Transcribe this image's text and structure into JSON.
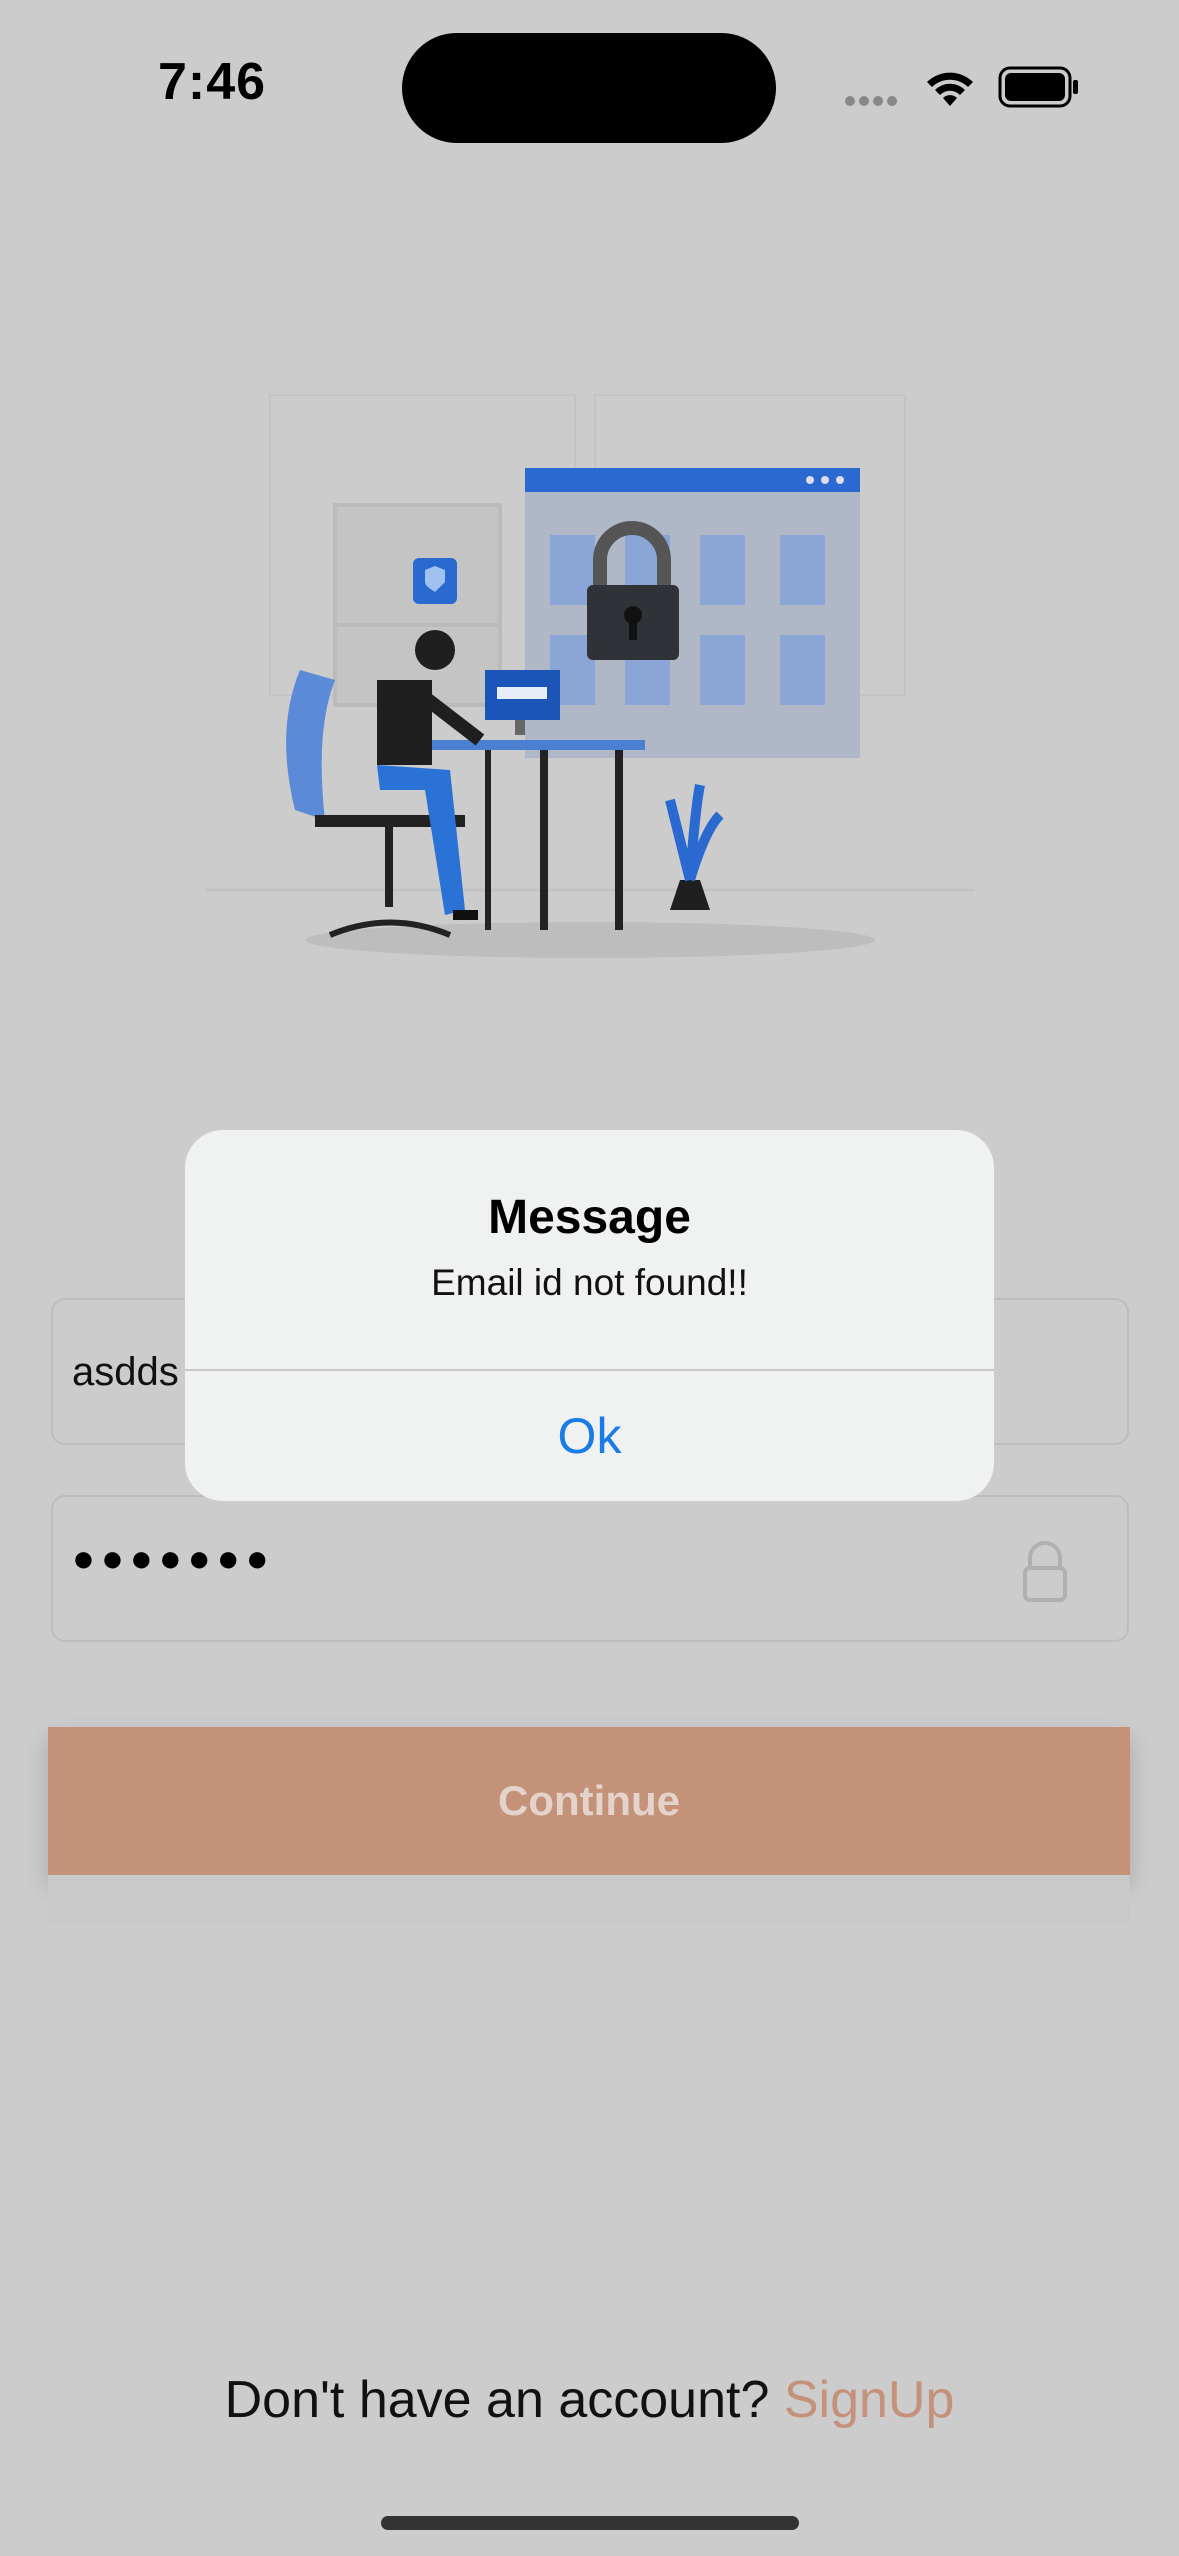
{
  "status_bar": {
    "time": "7:46"
  },
  "login": {
    "email_value": "asdds",
    "password_masked": "●●●●●●●",
    "continue_label": "Continue",
    "signup_prompt": "Don't have an account?",
    "signup_link": "SignUp"
  },
  "alert": {
    "title": "Message",
    "message": "Email id not found!!",
    "ok_label": "Ok"
  },
  "colors": {
    "accent": "#c49179",
    "signup_link": "#c4917a",
    "alert_button": "#1a7ae6"
  },
  "icons": [
    "wifi-icon",
    "battery-icon",
    "lock-icon"
  ]
}
